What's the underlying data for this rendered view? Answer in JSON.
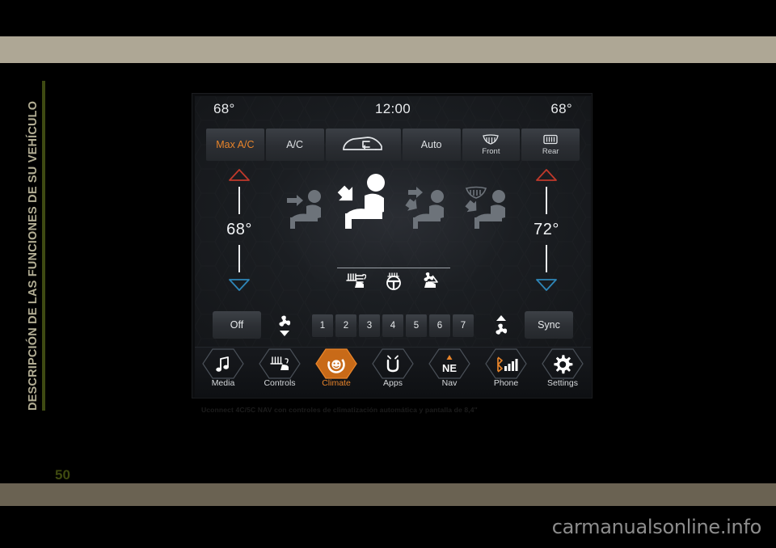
{
  "page": {
    "chapter_tab": "DESCRIPCIÓN DE LAS FUNCIONES DE SU VEHÍCULO",
    "page_number": "50",
    "caption": "Uconnect 4C/5C NAV con controles de climatización automática y pantalla de 8,4\"",
    "watermark": "carmanualsonline.info",
    "colors": {
      "band_top": "#aea795",
      "band_bottom": "#6a6252",
      "tab_text": "#b3ae94",
      "tab_rule": "#3e4a12",
      "page_number": "#3f4a10",
      "accent_orange": "#e8842a",
      "arrow_up_red": "#c0392b",
      "arrow_down_blue": "#2e86b8"
    }
  },
  "screen": {
    "status": {
      "left_temp": "68°",
      "clock": "12:00",
      "right_temp": "68°"
    },
    "mode_buttons": [
      {
        "label": "Max A/C",
        "sublabel": "",
        "icon": "",
        "active": true
      },
      {
        "label": "A/C",
        "sublabel": "",
        "icon": "",
        "active": false
      },
      {
        "label": "",
        "sublabel": "",
        "icon": "recirculation-icon",
        "active": false
      },
      {
        "label": "Auto",
        "sublabel": "",
        "icon": "",
        "active": false
      },
      {
        "label": "",
        "sublabel": "Front",
        "icon": "front-defrost-icon",
        "active": false
      },
      {
        "label": "",
        "sublabel": "Rear",
        "icon": "rear-defrost-icon",
        "active": false
      }
    ],
    "temp_left": {
      "value": "68°",
      "up_label": "increase",
      "down_label": "decrease"
    },
    "temp_right": {
      "value": "72°",
      "up_label": "increase",
      "down_label": "decrease"
    },
    "airflow_modes": [
      {
        "name": "face-airflow-icon",
        "active": false
      },
      {
        "name": "face-and-feet-airflow-icon",
        "active": true
      },
      {
        "name": "feet-airflow-icon",
        "active": false
      },
      {
        "name": "defrost-and-feet-airflow-icon",
        "active": false
      }
    ],
    "comfort_icons": [
      {
        "name": "heated-seat-icon"
      },
      {
        "name": "heated-steering-wheel-icon"
      },
      {
        "name": "ventilated-seat-icon"
      }
    ],
    "controls": {
      "off_label": "Off",
      "sync_label": "Sync",
      "fan_decrease": "fan-decrease-icon",
      "fan_increase": "fan-increase-icon",
      "fan_steps": [
        "1",
        "2",
        "3",
        "4",
        "5",
        "6",
        "7"
      ],
      "fan_active_index": -1
    },
    "nav_items": [
      {
        "label": "Media",
        "icon": "music-note-icon",
        "active": false
      },
      {
        "label": "Controls",
        "icon": "controls-icon",
        "active": false
      },
      {
        "label": "Climate",
        "icon": "climate-icon",
        "active": true
      },
      {
        "label": "Apps",
        "icon": "apps-u-icon",
        "active": false
      },
      {
        "label": "Nav",
        "icon": "compass-ne-icon",
        "active": false
      },
      {
        "label": "Phone",
        "icon": "phone-signal-icon",
        "active": false
      },
      {
        "label": "Settings",
        "icon": "gear-icon",
        "active": false
      }
    ]
  }
}
